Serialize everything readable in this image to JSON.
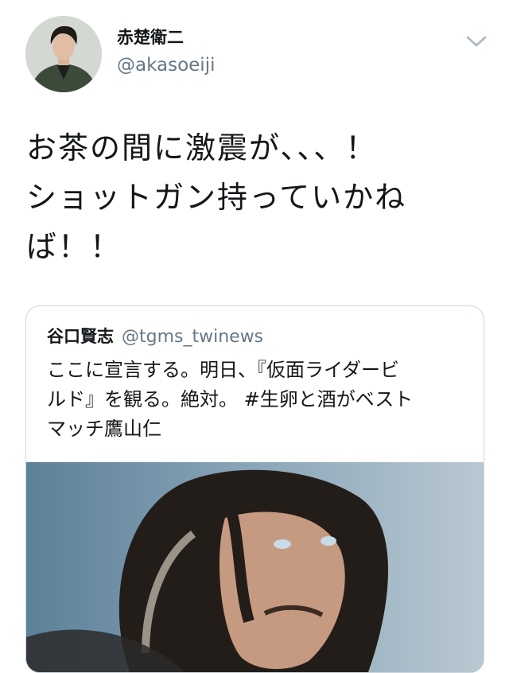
{
  "tweet": {
    "author": {
      "display_name": "赤楚衛二",
      "handle": "@akasoeiji",
      "avatar_icon": "user-avatar-photo"
    },
    "menu_icon": "chevron-down-icon",
    "text_lines": [
      "お茶の間に激震が、、、！",
      "ショットガン持っていかね",
      "ば！！"
    ]
  },
  "quoted_tweet": {
    "display_name": "谷口賢志",
    "handle": "@tgms_twinews",
    "text_lines": [
      "ここに宣言する。明日、『仮面ライダービ",
      "ルド』を観る。絶対。 #生卵と酒がベスト",
      "マッチ鷹山仁"
    ],
    "media_icon": "quoted-photo"
  },
  "colors": {
    "text_primary": "#14171a",
    "text_secondary": "#657786",
    "border": "#ccd6dd"
  }
}
